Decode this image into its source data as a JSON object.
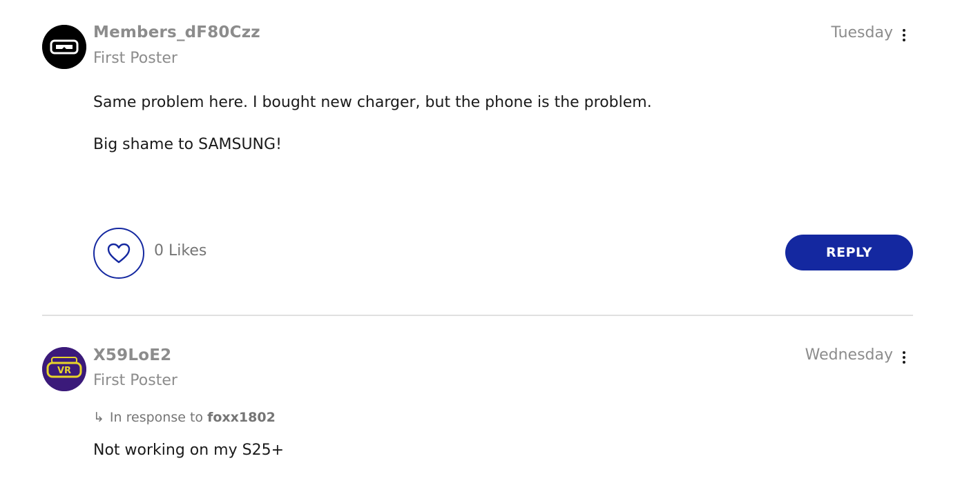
{
  "posts": [
    {
      "username": "Members_dF80Czz",
      "rank": "First Poster",
      "date": "Tuesday",
      "avatar_icon": "vr-headset-icon",
      "paragraphs": [
        "Same problem here. I bought new charger, but the phone is the problem.",
        "Big shame to SAMSUNG!"
      ],
      "likes": "0 Likes",
      "reply_label": "REPLY"
    },
    {
      "username": "X59LoE2",
      "rank": "First Poster",
      "date": "Wednesday",
      "avatar_icon": "vr-badge-icon",
      "avatar_text": "VR",
      "in_response_prefix": "In response to",
      "in_response_user": "foxx1802",
      "paragraphs": [
        "Not working on my S25+"
      ]
    }
  ],
  "colors": {
    "accent": "#1428a0",
    "muted_text": "#8c8c8c",
    "body_text": "#1a1a1a",
    "divider": "#e0e0e0"
  }
}
